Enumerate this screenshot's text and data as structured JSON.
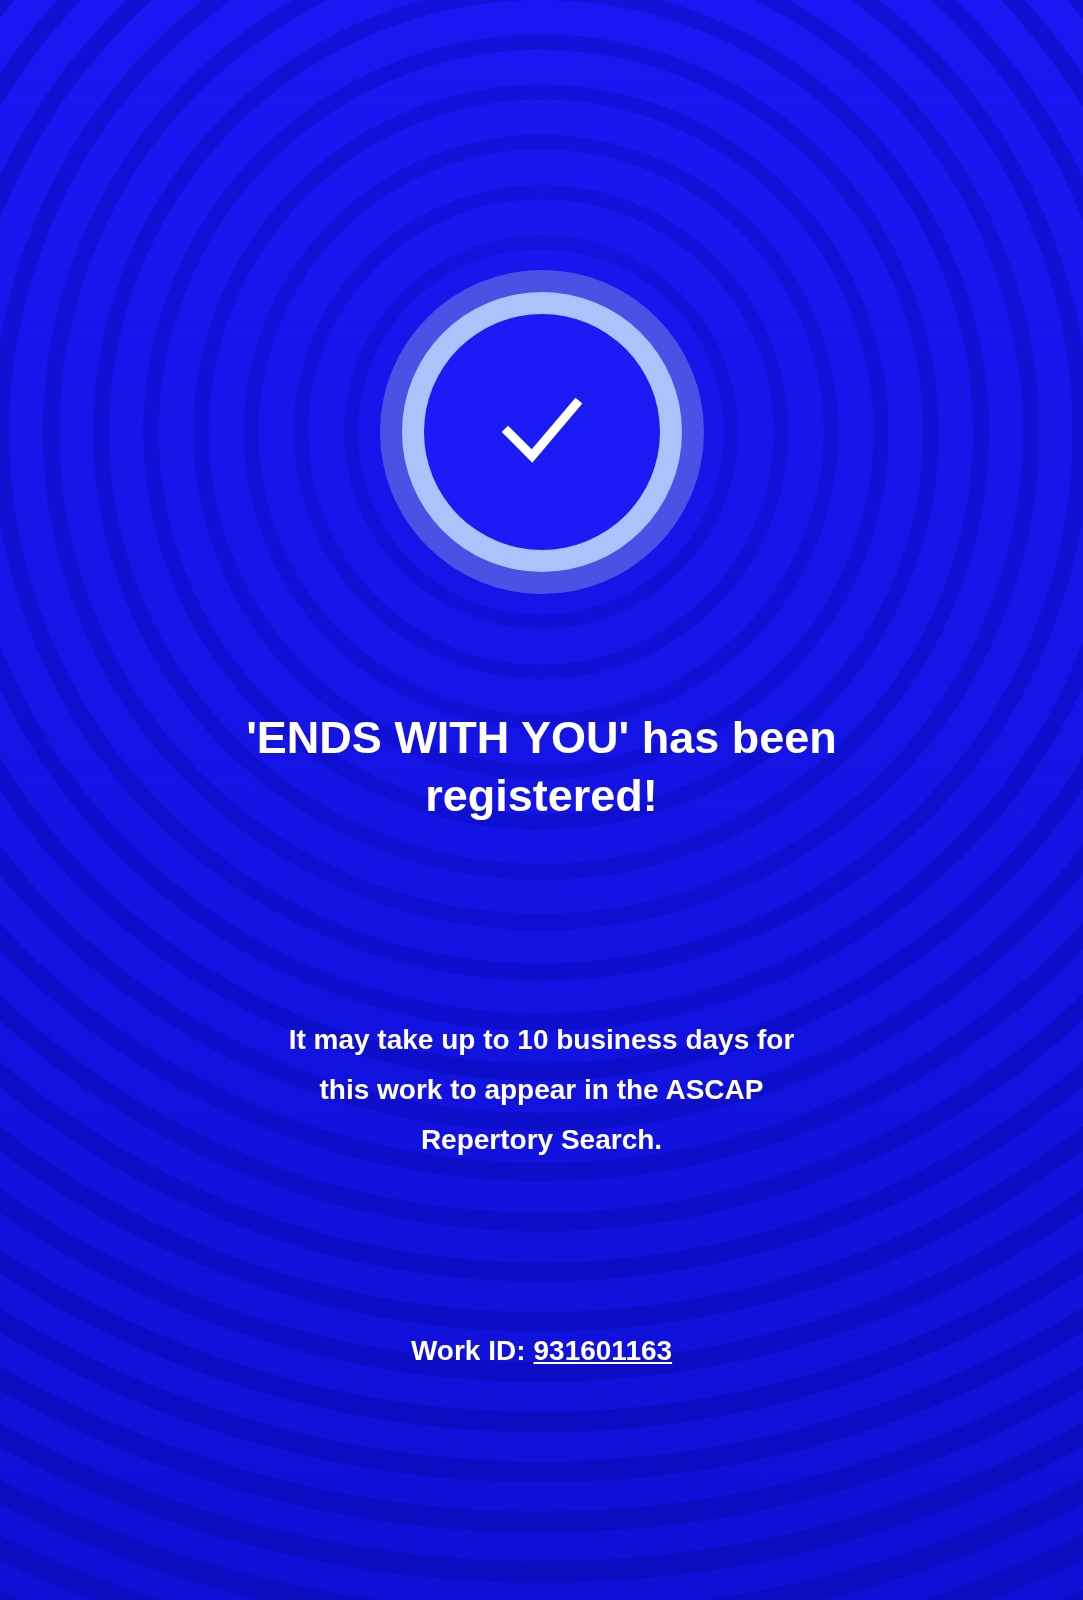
{
  "title": "'ENDS WITH YOU' has been registered!",
  "message": "It may take up to 10 business days for this work to appear in the ASCAP Repertory Search.",
  "work_id": {
    "label": "Work ID:",
    "value": "931601163"
  }
}
